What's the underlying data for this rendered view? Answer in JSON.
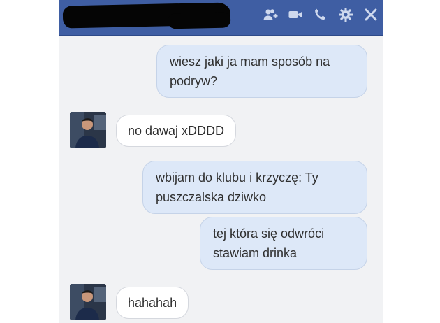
{
  "window": {
    "title_redacted": true,
    "colors": {
      "titlebar": "#3f5ea3",
      "chat_bg": "#f1f2f4",
      "outgoing_bubble": "#dde8f8",
      "incoming_bubble": "#ffffff"
    },
    "toolbar_icons": [
      "add-person-icon",
      "video-camera-icon",
      "phone-icon",
      "gear-icon",
      "close-icon"
    ]
  },
  "messages": [
    {
      "direction": "out",
      "text": "wiesz jaki ja mam sposób na podryw?"
    },
    {
      "direction": "in",
      "text": "no dawaj xDDDD"
    },
    {
      "direction": "out",
      "text": "wbijam do klubu i krzyczę: Ty puszczalska dziwko"
    },
    {
      "direction": "out",
      "text": "tej która się odwróci stawiam drinka"
    },
    {
      "direction": "in",
      "text": "hahahah"
    }
  ]
}
